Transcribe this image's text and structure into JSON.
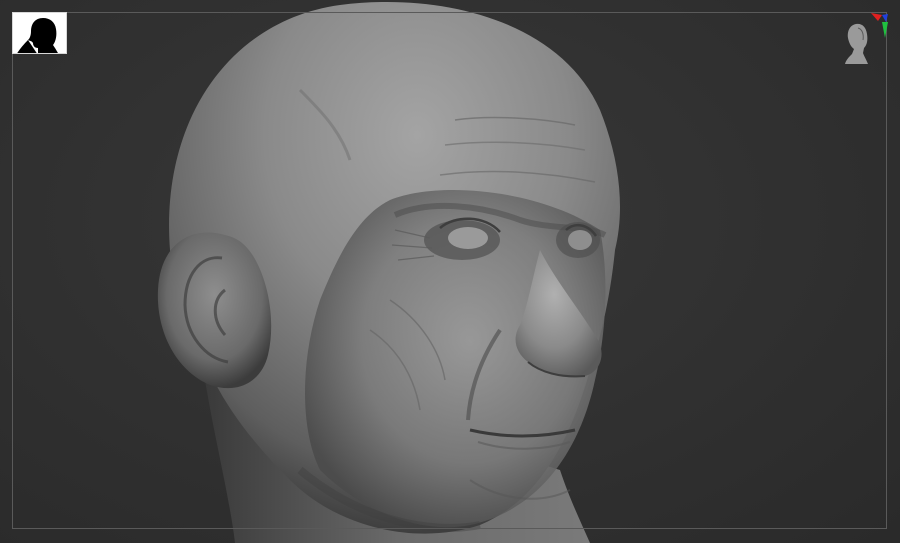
{
  "viewport": {
    "background_color": "#2f2f2f",
    "frame_color": "#5a5a5a",
    "model_color": "#8a8a8a"
  },
  "thumbnail": {
    "icon": "head-silhouette-icon",
    "background_color": "#ffffff",
    "silhouette_color": "#000000"
  },
  "navigation_gizmo": {
    "icon": "head-orientation-icon",
    "axis_colors": {
      "x": "#e02020",
      "y": "#20c040",
      "z": "#2040e0"
    }
  },
  "model": {
    "icon": "sculpted-head-mesh"
  }
}
